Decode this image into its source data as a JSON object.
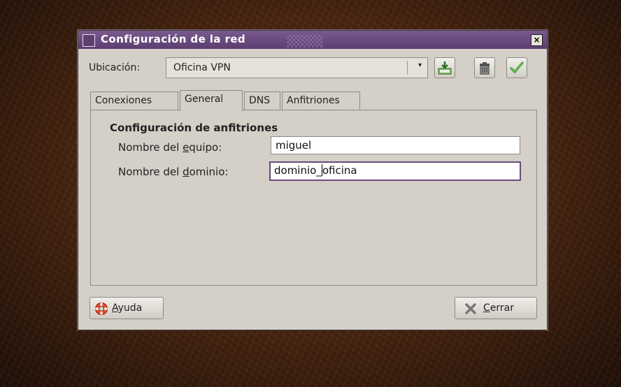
{
  "window": {
    "title": "Configuración de la red",
    "close_glyph": "×"
  },
  "location": {
    "label": "Ubicación:",
    "value": "Oficina VPN",
    "buttons": [
      "save-icon",
      "delete-icon",
      "apply-icon"
    ]
  },
  "tabs": [
    {
      "label": "Conexiones"
    },
    {
      "label": "General"
    },
    {
      "label": "DNS"
    },
    {
      "label": "Anfitriones"
    }
  ],
  "active_tab": "General",
  "general": {
    "section_title": "Configuración de anfitriones",
    "hostname_label_pre": "Nombre del ",
    "hostname_label_mnemonic": "e",
    "hostname_label_post": "quipo:",
    "hostname_value": "miguel",
    "domain_label_pre": "Nombre del ",
    "domain_label_mnemonic": "d",
    "domain_label_post": "ominio:",
    "domain_value_before_caret": "dominio_",
    "domain_value_after_caret": "oficina"
  },
  "footer": {
    "help_mnemonic": "A",
    "help_rest": "yuda",
    "close_mnemonic": "C",
    "close_rest": "errar"
  },
  "colors": {
    "titlebar": "#5b3d70",
    "dialog_bg": "#d4d0c8",
    "focus_border": "#6a4a7e",
    "desktop": "#4e2710"
  }
}
